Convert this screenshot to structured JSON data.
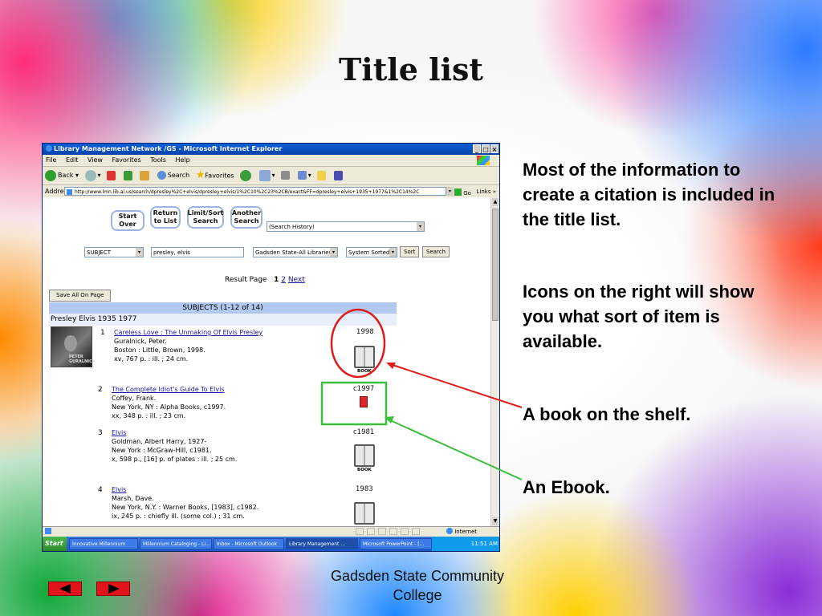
{
  "slide": {
    "title": "Title list",
    "notes": [
      "Most of the information to create a citation is included in the title list.",
      "Icons on the right will show you what sort of item is available.",
      "A book on the shelf.",
      "An Ebook."
    ],
    "footer_line1": "Gadsden State Community",
    "footer_line2": "College",
    "nav": {
      "prev_icon": "left-arrow-icon",
      "next_icon": "right-arrow-icon"
    },
    "colors": {
      "book_highlight": "#e11a1a",
      "ebook_highlight": "#3cbf3c",
      "nav_button": "#e2141b"
    }
  },
  "browser": {
    "title": "Library Management Network /GS - Microsoft Internet Explorer",
    "window_buttons": [
      "_",
      "□",
      "×"
    ],
    "menu": [
      "File",
      "Edit",
      "View",
      "Favorites",
      "Tools",
      "Help"
    ],
    "toolbar": {
      "back": "Back",
      "search": "Search",
      "favorites": "Favorites"
    },
    "address_label": "Address",
    "url": "http://www.lmn.lib.al.us/search/dpresley%2C+elvis/dpresley+elvis/1%2C10%2C23%2CB/exact&FF=dpresley+elvis+1935+1977&1%2C14%2C",
    "go": "Go",
    "links": "Links »",
    "status_zone": "Internet"
  },
  "catalog": {
    "buttons": {
      "start_over": [
        "Start Over"
      ],
      "return_to_list": [
        "Return",
        "to List"
      ],
      "limit_sort": [
        "Limit/Sort",
        "Search"
      ],
      "another_search": [
        "Another",
        "Search"
      ]
    },
    "search_history": "(Search History)",
    "search_type": "SUBJECT",
    "search_term": "presley, elvis",
    "library": "Gadsden State-All Libraries",
    "sort_mode": "System Sorted",
    "sort_button": "Sort",
    "search_button": "Search",
    "result_page_label": "Result Page",
    "result_pages": [
      "1",
      "2"
    ],
    "next_label": "Next",
    "save_all": "Save All On Page",
    "subjects_header": "SUBJECTS (1-12 of 14)",
    "subject_heading": "Presley Elvis 1935 1977",
    "records": [
      {
        "num": "1",
        "title": "Careless Love : The Unmaking Of Elvis Presley",
        "author": "Guralnick, Peter.",
        "pub": "Boston : Little, Brown, 1998.",
        "desc": "xv, 767 p. : ill. ; 24 cm.",
        "year": "1998",
        "format": "BOOK",
        "cover_text": "PETER GURALNICK"
      },
      {
        "num": "2",
        "title": "The Complete Idiot's Guide To Elvis",
        "author": "Coffey, Frank.",
        "pub": "New York, NY : Alpha Books, c1997.",
        "desc": "xx, 348 p. : ill. ; 23 cm.",
        "year": "c1997",
        "format": "EBOOK"
      },
      {
        "num": "3",
        "title": "Elvis",
        "author": "Goldman, Albert Harry, 1927-",
        "pub": "New York : McGraw-Hill, c1981.",
        "desc": "x, 598 p., [16] p. of plates : ill. ; 25 cm.",
        "year": "c1981",
        "format": "BOOK"
      },
      {
        "num": "4",
        "title": "Elvis",
        "author": "Marsh, Dave.",
        "pub": "New York, N.Y. : Warner Books, [1983], c1982.",
        "desc": "ix, 245 p. : chiefly ill. (some col.) ; 31 cm.",
        "year": "1983",
        "format": "BOOK"
      }
    ]
  },
  "taskbar": {
    "start": "Start",
    "tasks": [
      "Innovative Millennium",
      "Millennium Cataloging - Li...",
      "Inbox - Microsoft Outlook",
      "Library Management ...",
      "Microsoft PowerPoint - [..."
    ],
    "clock": "11:51 AM"
  }
}
